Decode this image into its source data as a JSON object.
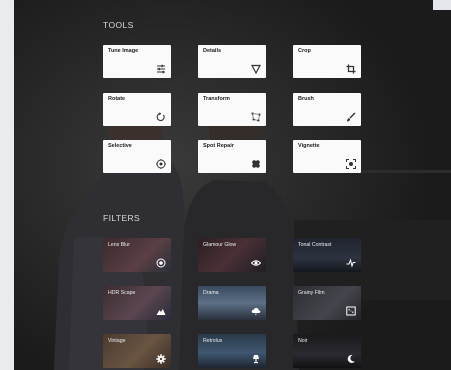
{
  "sections": {
    "tools": "TOOLS",
    "filters": "FILTERS"
  },
  "tools": [
    {
      "label": "Tune Image",
      "icon": "sliders-icon"
    },
    {
      "label": "Details",
      "icon": "triangle-icon"
    },
    {
      "label": "Crop",
      "icon": "crop-icon"
    },
    {
      "label": "Rotate",
      "icon": "rotate-icon"
    },
    {
      "label": "Transform",
      "icon": "transform-icon"
    },
    {
      "label": "Brush",
      "icon": "brush-icon"
    },
    {
      "label": "Selective",
      "icon": "selective-icon"
    },
    {
      "label": "Spot Repair",
      "icon": "bandage-icon"
    },
    {
      "label": "Vignette",
      "icon": "vignette-icon"
    }
  ],
  "filters": [
    {
      "label": "Lens Blur",
      "icon": "lens-blur-icon"
    },
    {
      "label": "Glamour Glow",
      "icon": "eye-icon"
    },
    {
      "label": "Tonal Contrast",
      "icon": "pulse-icon"
    },
    {
      "label": "HDR Scape",
      "icon": "mountain-icon"
    },
    {
      "label": "Drama",
      "icon": "cloud-icon"
    },
    {
      "label": "Grainy Film",
      "icon": "film-icon"
    },
    {
      "label": "Vintage",
      "icon": "gear-icon"
    },
    {
      "label": "Retrolux",
      "icon": "lamp-icon"
    },
    {
      "label": "Noir",
      "icon": "moon-icon"
    }
  ],
  "colors": {
    "panel_bg": "#1e1e1e",
    "tile_bg": "#fafafa",
    "tile_text": "#222222",
    "section_text": "#d8d8d8"
  }
}
